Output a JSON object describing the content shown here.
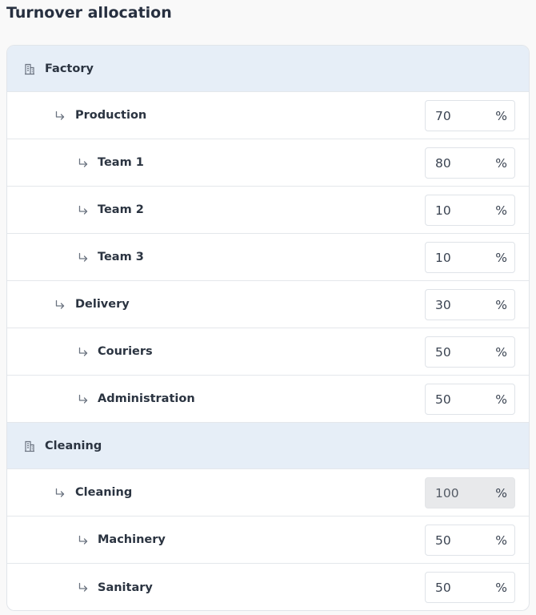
{
  "page": {
    "title": "Turnover allocation",
    "percent_sign": "%"
  },
  "groups": [
    {
      "label": "Factory",
      "icon": "building-icon",
      "rows": [
        {
          "label": "Production",
          "level": 1,
          "value": "70",
          "disabled": false
        },
        {
          "label": "Team 1",
          "level": 2,
          "value": "80",
          "disabled": false
        },
        {
          "label": "Team 2",
          "level": 2,
          "value": "10",
          "disabled": false
        },
        {
          "label": "Team 3",
          "level": 2,
          "value": "10",
          "disabled": false
        },
        {
          "label": "Delivery",
          "level": 1,
          "value": "30",
          "disabled": false
        },
        {
          "label": "Couriers",
          "level": 2,
          "value": "50",
          "disabled": false
        },
        {
          "label": "Administration",
          "level": 2,
          "value": "50",
          "disabled": false
        }
      ]
    },
    {
      "label": "Cleaning",
      "icon": "building-icon",
      "rows": [
        {
          "label": "Cleaning",
          "level": 1,
          "value": "100",
          "disabled": true
        },
        {
          "label": "Machinery",
          "level": 2,
          "value": "50",
          "disabled": false
        },
        {
          "label": "Sanitary",
          "level": 2,
          "value": "50",
          "disabled": false
        }
      ]
    }
  ],
  "colors": {
    "group_background": "#e6eef7",
    "text": "#2b3441",
    "icon": "#6b7380",
    "border": "#e4e7eb",
    "disabled_field": "#e8e9eb"
  }
}
